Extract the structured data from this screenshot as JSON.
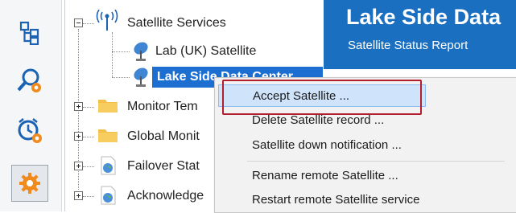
{
  "rail": {
    "items": [
      {
        "icon": "tree-structure-icon"
      },
      {
        "icon": "search-settings-icon"
      },
      {
        "icon": "alarm-clock-settings-icon"
      },
      {
        "icon": "gear-icon"
      }
    ]
  },
  "tree": {
    "root_label": "Satellite Services",
    "child1_label": "Lab (UK) Satellite",
    "child2_label": "Lake Side Data Center",
    "items": [
      {
        "label": "Monitor Tem"
      },
      {
        "label": "Global Monit"
      },
      {
        "label": "Failover Stat"
      },
      {
        "label": "Acknowledge"
      }
    ]
  },
  "banner": {
    "title": "Lake Side Data",
    "subtitle": "Satellite Status Report"
  },
  "menu": {
    "items": [
      {
        "label": "Accept Satellite ..."
      },
      {
        "label": "Delete Satellite record ..."
      },
      {
        "label": "Satellite down notification ..."
      },
      {
        "label": "Rename remote Satellite ..."
      },
      {
        "label": "Restart remote Satellite service"
      }
    ]
  },
  "colors": {
    "accent": "#1a6fc0",
    "selection": "#1c6fd1",
    "highlight_border": "#b21e2b"
  }
}
